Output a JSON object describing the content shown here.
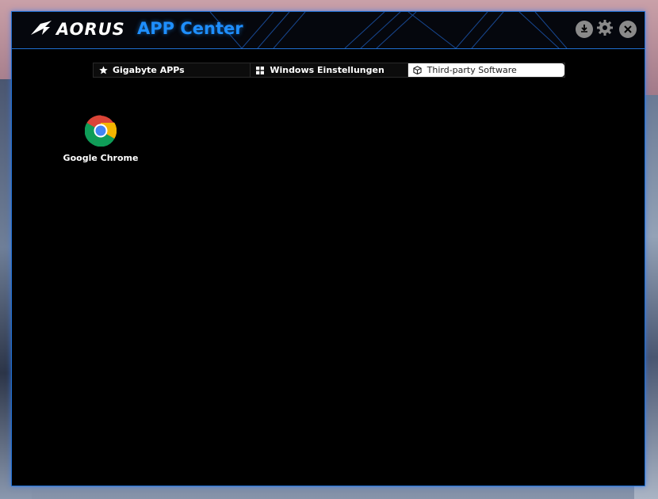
{
  "header": {
    "brand": "AORUS",
    "title": "APP Center"
  },
  "window_controls": [
    {
      "name": "download-icon"
    },
    {
      "name": "gear-icon"
    },
    {
      "name": "close-icon"
    }
  ],
  "tabs": [
    {
      "label": "Gigabyte APPs",
      "icon": "star-icon",
      "active": false
    },
    {
      "label": "Windows Einstellungen",
      "icon": "windows-icon",
      "active": false
    },
    {
      "label": "Third-party Software",
      "icon": "box-icon",
      "active": true
    }
  ],
  "apps": [
    {
      "label": "Google Chrome",
      "icon": "chrome-icon"
    }
  ],
  "colors": {
    "accent": "#1e8fff",
    "window_bg": "#000000",
    "border": "#1f6fd0"
  }
}
